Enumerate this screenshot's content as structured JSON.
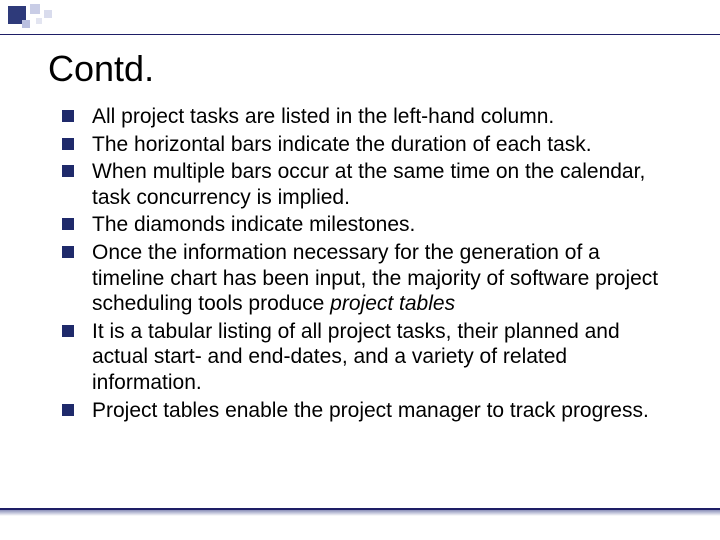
{
  "title": "Contd.",
  "bullets": [
    {
      "text": "All project tasks are listed in the left-hand column."
    },
    {
      "text": "The horizontal bars indicate the duration of each task."
    },
    {
      "text": "When multiple bars occur at the same time on the calendar, task concurrency is implied."
    },
    {
      "text": "The diamonds indicate milestones."
    },
    {
      "text": "Once the information necessary for the generation of a timeline chart has been input, the majority of software project scheduling tools produce ",
      "em": "project tables"
    },
    {
      "text": "It is a tabular listing of all project tasks, their planned and actual start- and end-dates, and a variety of related information."
    },
    {
      "text": "Project tables enable the project manager to track progress."
    }
  ]
}
